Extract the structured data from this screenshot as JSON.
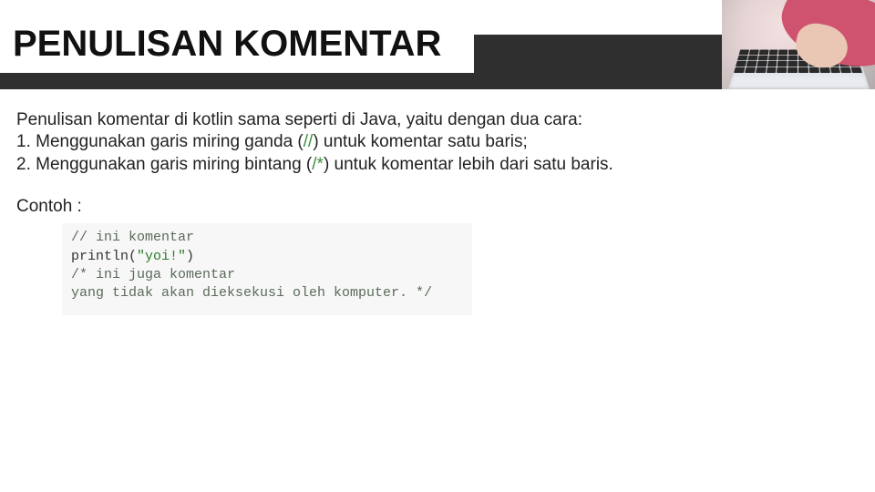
{
  "header": {
    "title": "PENULISAN KOMENTAR"
  },
  "body": {
    "line_intro": "Penulisan komentar di kotlin sama seperti di Java, yaitu dengan dua cara:",
    "line1_pre": "1. Menggunakan garis miring ganda (",
    "line1_sym": "//",
    "line1_post": ") untuk komentar satu baris;",
    "line2_pre": "2. Menggunakan garis miring bintang (",
    "line2_sym": "/*",
    "line2_post": ") untuk komentar lebih dari satu baris.",
    "contoh_label": "Contoh :"
  },
  "code": {
    "c1": "// ini komentar",
    "call": "println",
    "paren_open": "(",
    "str": "\"yoi!\"",
    "paren_close": ")",
    "c3": "/* ini juga komentar",
    "c4": "yang tidak akan dieksekusi oleh komputer. */"
  }
}
